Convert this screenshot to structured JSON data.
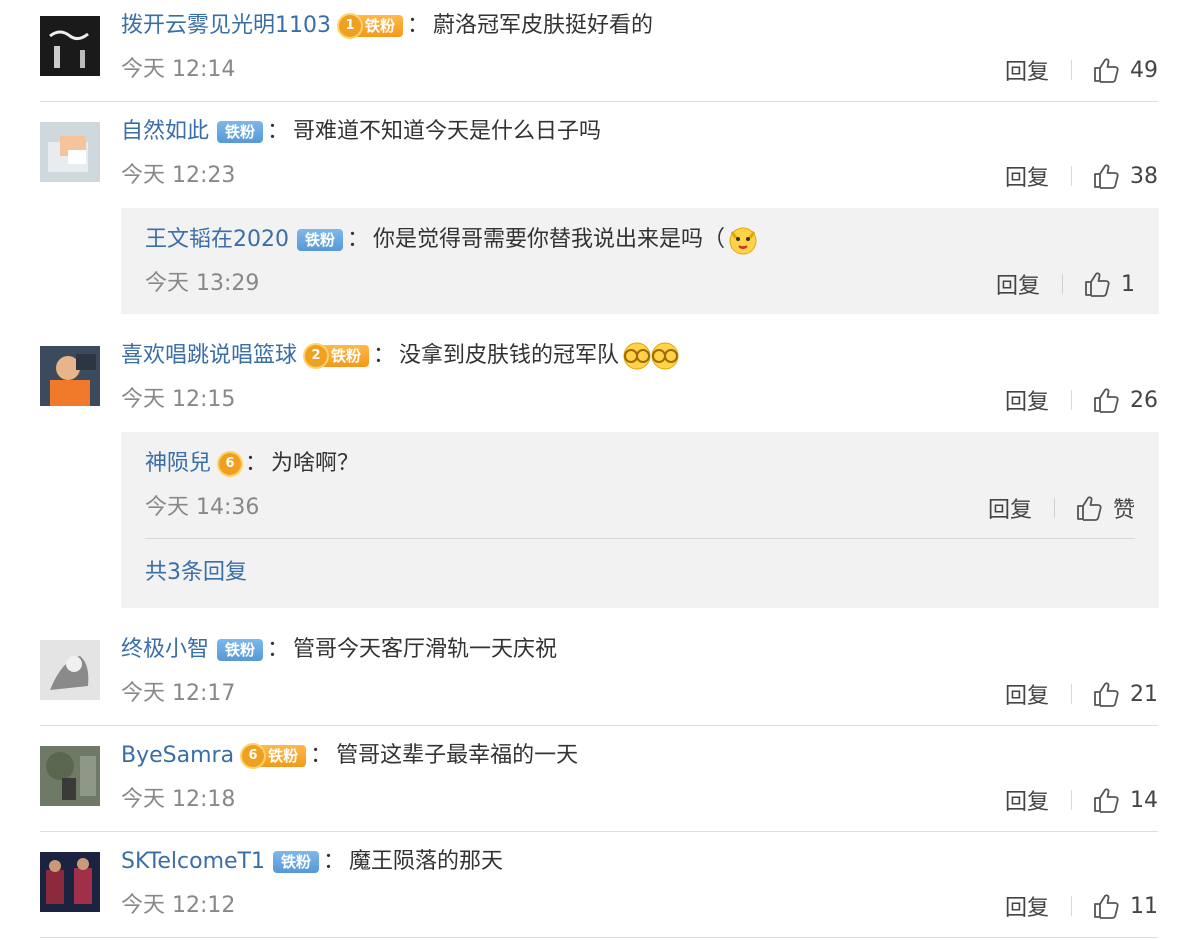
{
  "comments": [
    {
      "user": "拨开云雾见光明1103",
      "badge": "铁粉",
      "level": "1",
      "text": "蔚洛冠军皮肤挺好看的",
      "time": "今天 12:14",
      "reply": "回复",
      "likes": "49"
    },
    {
      "user": "自然如此",
      "badge": "铁粉",
      "text": "哥难道不知道今天是什么日子吗",
      "time": "今天 12:23",
      "reply": "回复",
      "likes": "38",
      "sub": {
        "user": "王文韬在2020",
        "badge": "铁粉",
        "text": "你是觉得哥需要你替我说出来是吗（",
        "time": "今天 13:29",
        "reply": "回复",
        "likes": "1"
      }
    },
    {
      "user": "喜欢唱跳说唱篮球",
      "badge": "铁粉",
      "level": "2",
      "text": "没拿到皮肤钱的冠军队",
      "time": "今天 12:15",
      "reply": "回复",
      "likes": "26",
      "sub": {
        "user": "神陨兒",
        "level": "6",
        "text": "为啥啊？",
        "time": "今天 14:36",
        "reply": "回复",
        "likes": "赞",
        "more": "共3条回复"
      }
    },
    {
      "user": "终极小智",
      "badge": "铁粉",
      "text": "管哥今天客厅滑轨一天庆祝",
      "time": "今天 12:17",
      "reply": "回复",
      "likes": "21"
    },
    {
      "user": "ByeSamra",
      "badge": "铁粉",
      "level": "6",
      "text": "管哥这辈子最幸福的一天",
      "time": "今天 12:18",
      "reply": "回复",
      "likes": "14"
    },
    {
      "user": "SKTelcomeT1",
      "badge": "铁粉",
      "text": "魔王陨落的那天",
      "time": "今天 12:12",
      "reply": "回复",
      "likes": "11"
    }
  ],
  "colors": {
    "username": "#3a6ea8",
    "gold_badge": "#f29a19",
    "blue_badge": "#5699d6",
    "subbox_bg": "#f2f2f2"
  },
  "icons": {
    "like": "thumbs-up-icon",
    "emoji_dog": "dog-face-emoji",
    "emoji_ok": "ok-hand-emoji"
  }
}
